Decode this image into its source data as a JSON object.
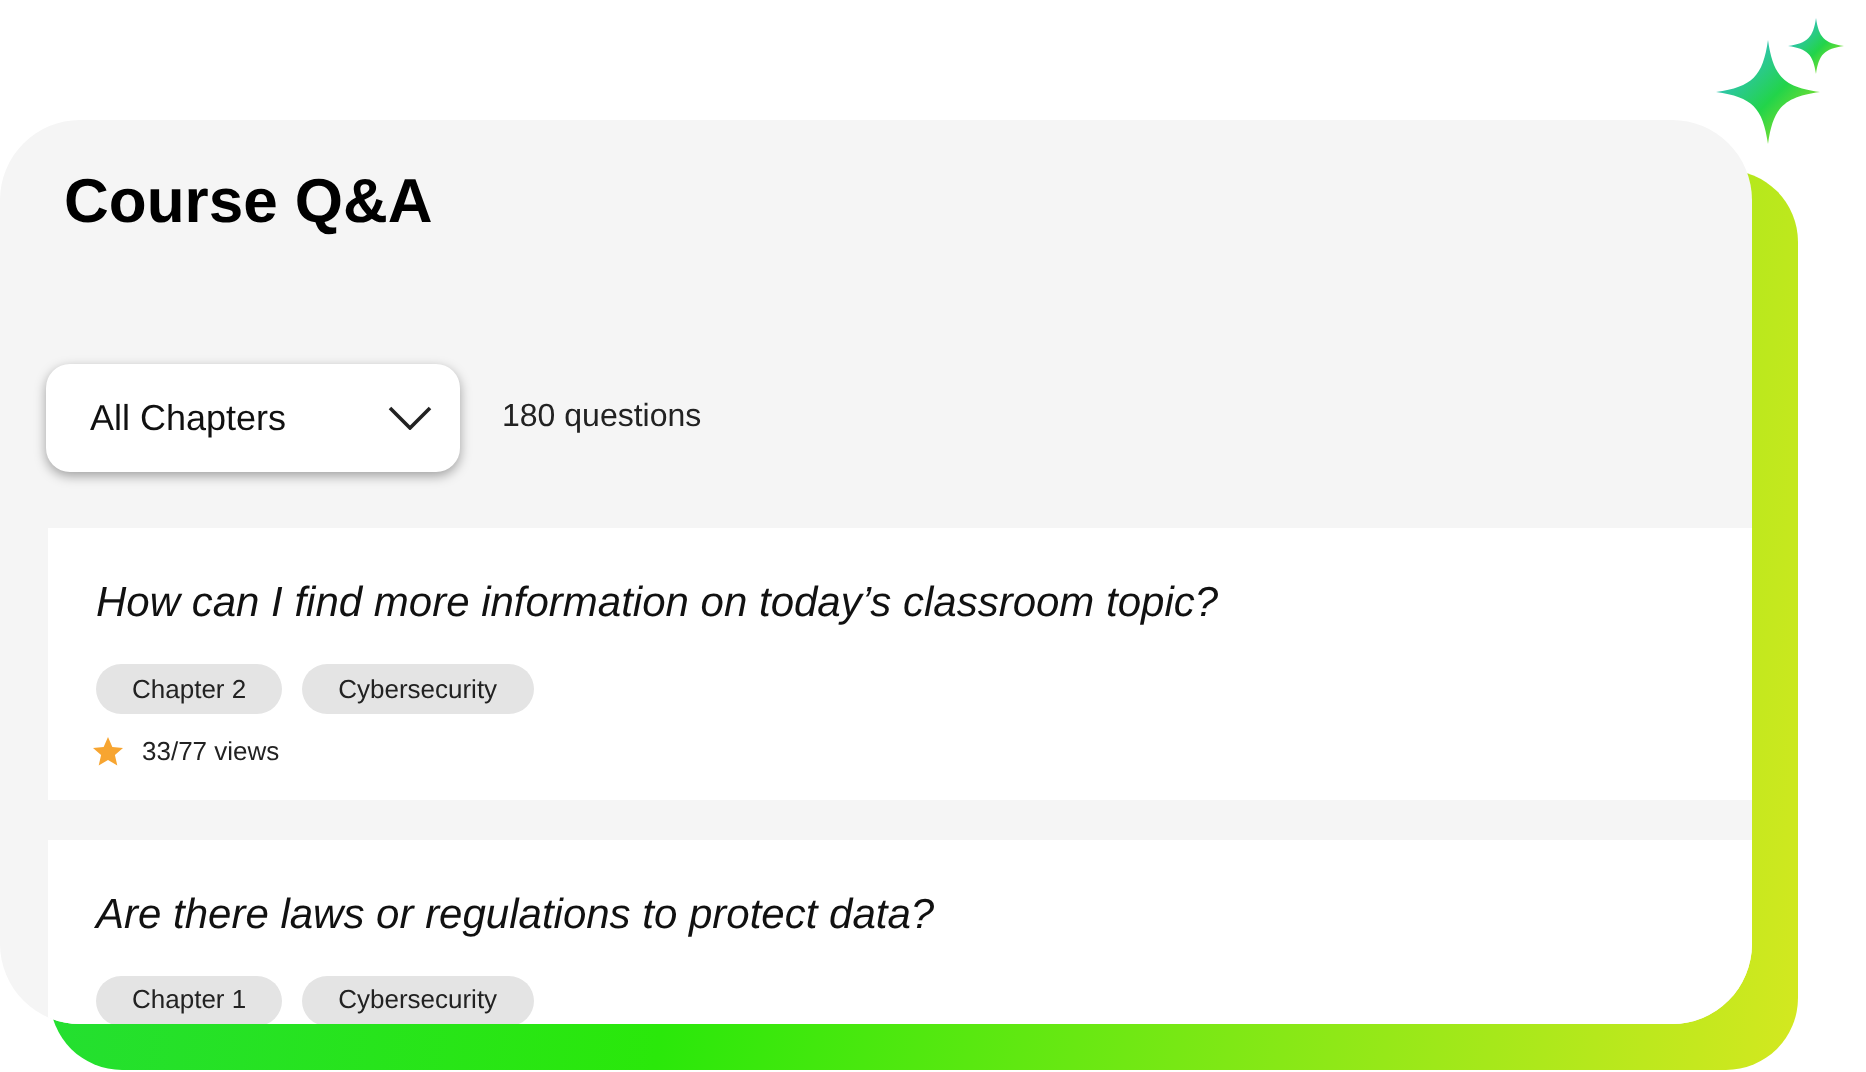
{
  "title": "Course Q&A",
  "filter": {
    "value": "All Chapters"
  },
  "question_count": "180 questions",
  "questions": [
    {
      "title": "How can I find more information on today’s classroom topic?",
      "tags": [
        "Chapter 2",
        "Cybersecurity"
      ],
      "views": "33/77 views"
    },
    {
      "title": "Are there laws or regulations to protect data?",
      "tags": [
        "Chapter 1",
        "Cybersecurity"
      ]
    }
  ]
}
